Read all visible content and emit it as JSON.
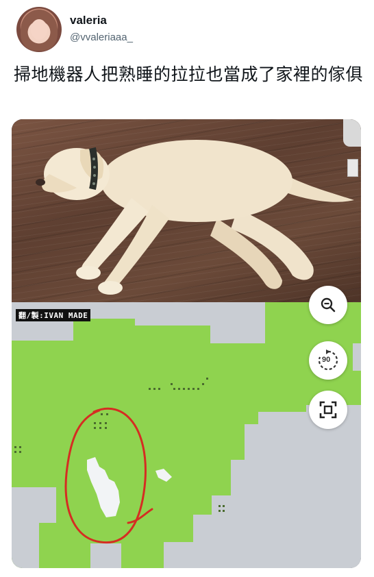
{
  "user": {
    "display_name": "valeria",
    "handle": "@vvaleriaaa_"
  },
  "tweet": {
    "text": "掃地機器人把熟睡的拉拉也當成了家裡的傢俱"
  },
  "media": {
    "watermark": "翻/製:IVAN MADE",
    "map_controls": {
      "zoom_icon": "zoom-out-icon",
      "rotate_icon": "rotate-icon",
      "rotate_label": "90",
      "fit_icon": "fit-screen-icon"
    }
  },
  "colors": {
    "map_green": "#8fd34f",
    "map_gray": "#c9cdd3",
    "obstacle_white": "#f2f4f6",
    "circle_red": "#d52d22"
  }
}
